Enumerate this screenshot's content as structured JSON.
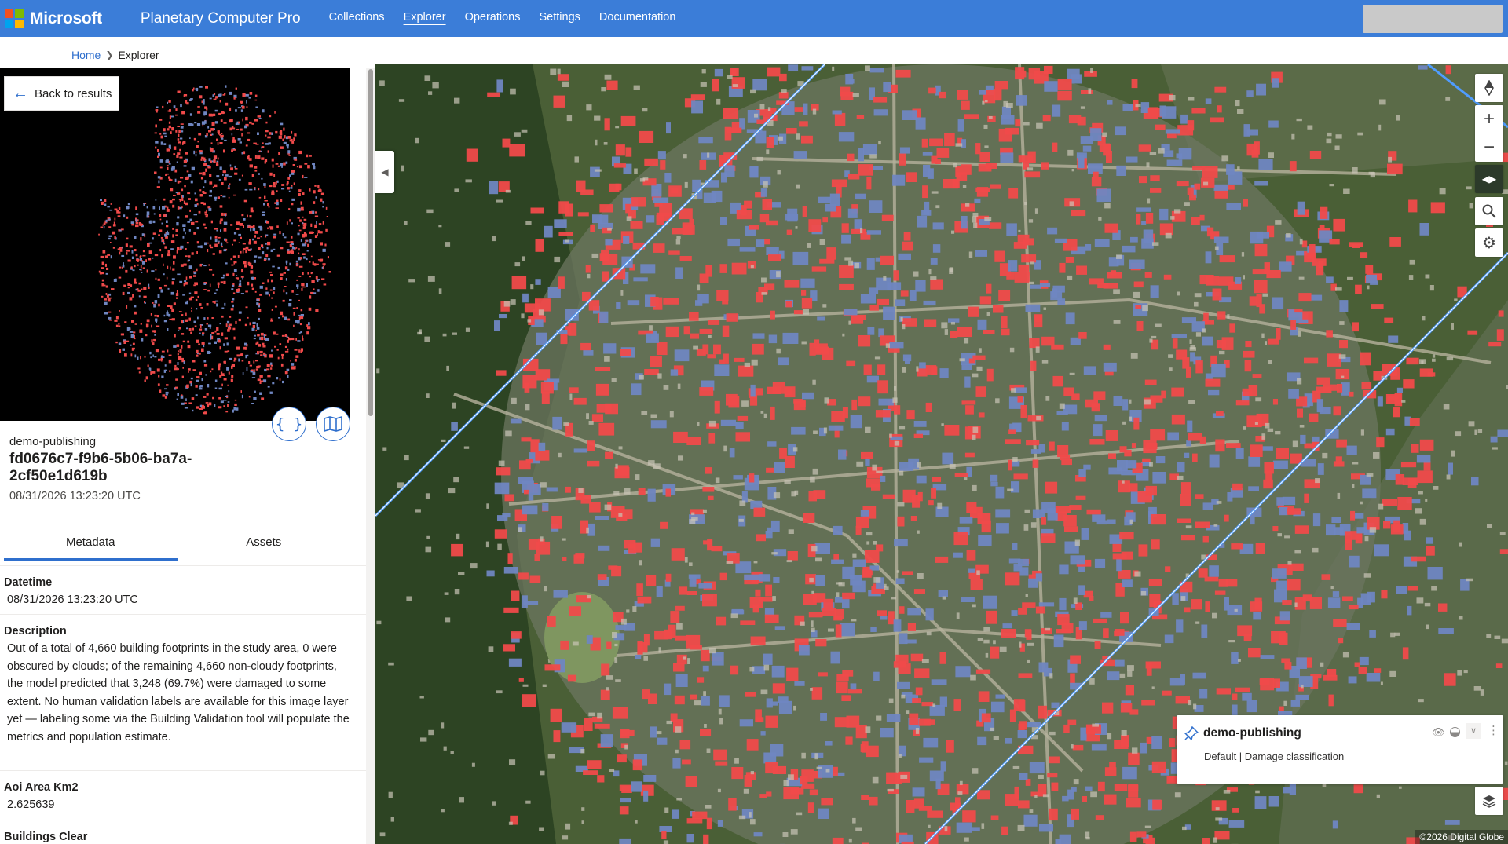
{
  "header": {
    "brand": "Microsoft",
    "product": "Planetary Computer Pro",
    "nav": [
      "Collections",
      "Explorer",
      "Operations",
      "Settings",
      "Documentation"
    ],
    "active_nav": "Explorer"
  },
  "breadcrumb": {
    "home": "Home",
    "current": "Explorer"
  },
  "panel": {
    "back_label": "Back to results",
    "collection": "demo-publishing",
    "item_id": "fd0676c7-f9b6-5b06-ba7a-2cf50e1d619b",
    "datetime": "08/31/2026 13:23:20 UTC",
    "tabs": [
      "Metadata",
      "Assets"
    ],
    "metadata": [
      {
        "label": "Datetime",
        "value": "08/31/2026 13:23:20 UTC"
      },
      {
        "label": "Description",
        "value": "Out of a total of 4,660 building footprints in the study area, 0 were obscured by clouds; of the remaining 4,660 non-cloudy footprints, the model predicted that 3,248 (69.7%) were damaged to some extent. No human validation labels are available for this image layer yet — labeling some via the Building Validation tool will populate the metrics and population estimate."
      },
      {
        "label": "Aoi Area Km2",
        "value": "2.625639"
      },
      {
        "label": "Buildings Clear",
        "value": ""
      }
    ]
  },
  "map": {
    "layer": {
      "name": "demo-publishing",
      "subtitle": "Default | Damage classification"
    },
    "attribution": "©2026 Digital Globe",
    "colors": {
      "damaged": "#f04a4a",
      "undamaged": "#6f86c1",
      "outline": "#4f9cff",
      "accent": "#2f6fcd"
    }
  }
}
